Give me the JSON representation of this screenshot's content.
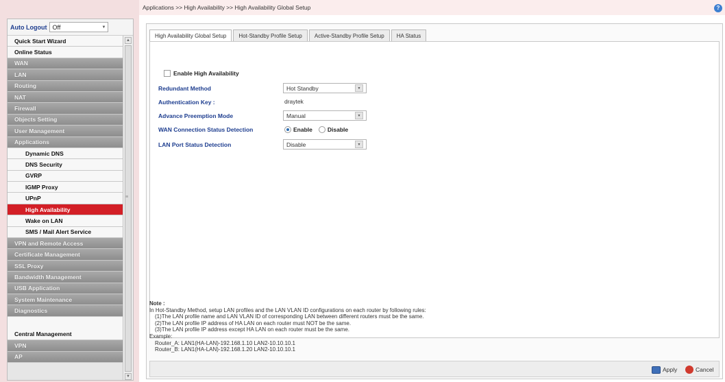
{
  "sidebar": {
    "auto_logout_label": "Auto Logout",
    "auto_logout_value": "Off",
    "menu": [
      {
        "label": "Quick Start Wizard",
        "style": "white"
      },
      {
        "label": "Online Status",
        "style": "white"
      },
      {
        "label": "WAN",
        "style": "gray"
      },
      {
        "label": "LAN",
        "style": "gray"
      },
      {
        "label": "Routing",
        "style": "gray"
      },
      {
        "label": "NAT",
        "style": "gray"
      },
      {
        "label": "Firewall",
        "style": "gray"
      },
      {
        "label": "Objects Setting",
        "style": "gray"
      },
      {
        "label": "User Management",
        "style": "gray"
      },
      {
        "label": "Applications",
        "style": "gray"
      },
      {
        "label": "Dynamic DNS",
        "style": "sub"
      },
      {
        "label": "DNS Security",
        "style": "sub"
      },
      {
        "label": "GVRP",
        "style": "sub"
      },
      {
        "label": "IGMP Proxy",
        "style": "sub"
      },
      {
        "label": "UPnP",
        "style": "sub"
      },
      {
        "label": "High Availability",
        "style": "active"
      },
      {
        "label": "Wake on LAN",
        "style": "sub"
      },
      {
        "label": "SMS / Mail Alert Service",
        "style": "sub"
      },
      {
        "label": "VPN and Remote Access",
        "style": "gray"
      },
      {
        "label": "Certificate Management",
        "style": "gray"
      },
      {
        "label": "SSL Proxy",
        "style": "gray"
      },
      {
        "label": "Bandwidth Management",
        "style": "gray"
      },
      {
        "label": "USB Application",
        "style": "gray"
      },
      {
        "label": "System Maintenance",
        "style": "gray"
      },
      {
        "label": "Diagnostics",
        "style": "gray"
      },
      {
        "label": "",
        "style": "gap"
      },
      {
        "label": "Central Management",
        "style": "white"
      },
      {
        "label": "VPN",
        "style": "gray"
      },
      {
        "label": "AP",
        "style": "gray"
      }
    ]
  },
  "breadcrumb": "Applications >> High Availability >> High Availability Global Setup",
  "tabs": [
    "High Availability Global Setup",
    "Hot-Standby Profile Setup",
    "Active-Standby Profile Setup",
    "HA Status"
  ],
  "form": {
    "enable_label": "Enable High Availability",
    "redundant_label": "Redundant Method",
    "redundant_value": "Hot Standby",
    "auth_label": "Authentication Key :",
    "auth_value": "draytek",
    "preemption_label": "Advance Preemption Mode",
    "preemption_value": "Manual",
    "wan_detect_label": "WAN Connection Status Detection",
    "wan_enable": "Enable",
    "wan_disable": "Disable",
    "lan_detect_label": "LAN Port Status Detection",
    "lan_detect_value": "Disable"
  },
  "note": {
    "title": "Note :",
    "lines": [
      "In Hot-Standby Method, setup LAN profiles and the LAN VLAN ID configurations on each router by following rules:",
      "(1)The LAN profile name and LAN VLAN ID of corresponding LAN between different routers must be the same.",
      "(2)The LAN profile IP address of HA LAN on each router must NOT be the same.",
      "(3)The LAN profile IP address except HA LAN on each router must be the same.",
      "Example:",
      "Router_A: LAN1(HA-LAN)-192.168.1.10  LAN2-10.10.10.1",
      "Router_B: LAN1(HA-LAN)-192.168.1.20  LAN2-10.10.10.1"
    ]
  },
  "footer": {
    "apply": "Apply",
    "cancel": "Cancel"
  },
  "colors": {
    "active_menu": "#d31f26",
    "label_blue": "#1d3d8f",
    "gray_menu": "#8d8d8d"
  }
}
